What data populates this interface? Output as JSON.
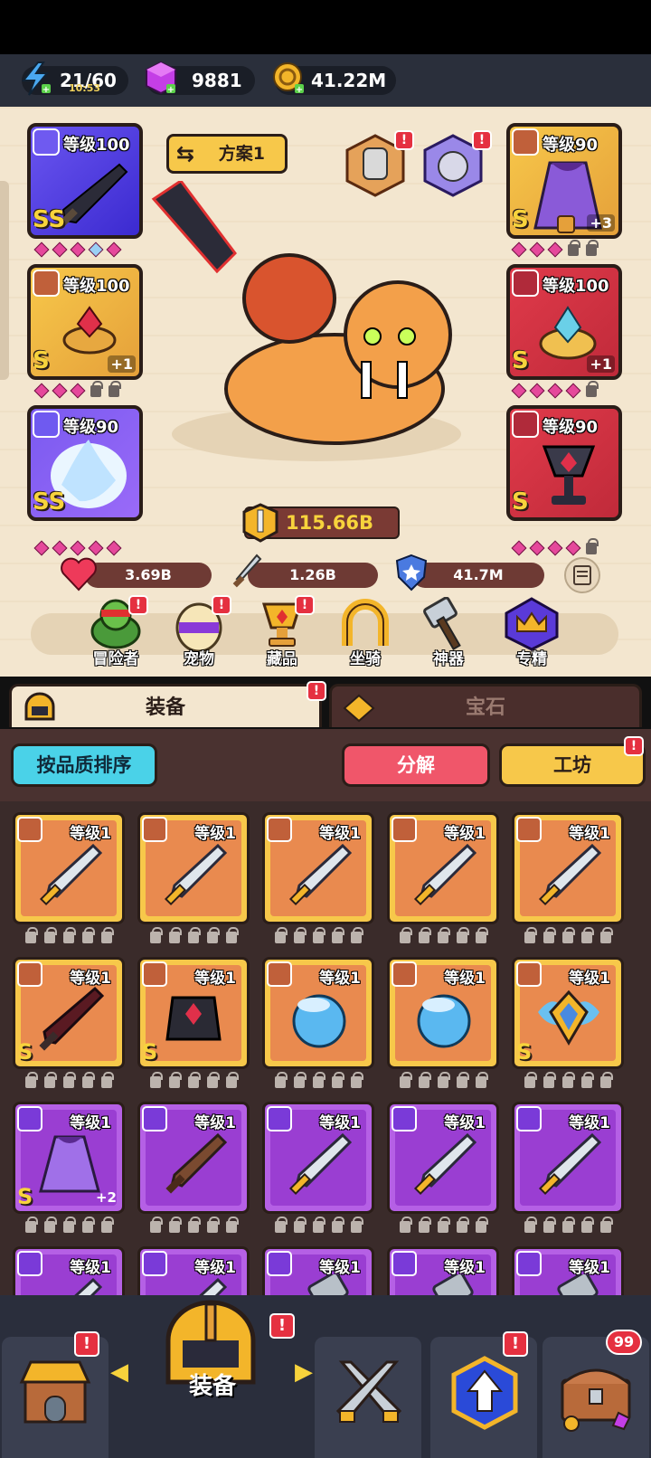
{
  "resources": {
    "energy": "21/60",
    "energy_timer": "10:53",
    "gems": "9881",
    "gold": "41.22M"
  },
  "loadout": {
    "plan_label": "方案1"
  },
  "equipped": {
    "weapon": {
      "level": "等级100",
      "grade": "SS"
    },
    "cape": {
      "level": "等级90",
      "grade": "S",
      "plus": "+3"
    },
    "ring": {
      "level": "等级100",
      "grade": "S",
      "plus": "+1"
    },
    "crown": {
      "level": "等级100",
      "grade": "S",
      "plus": "+1"
    },
    "amulet": {
      "level": "等级90",
      "grade": "SS"
    },
    "chalice": {
      "level": "等级90",
      "grade": "S"
    }
  },
  "power": "115.66B",
  "stats": {
    "hp": "3.69B",
    "attack": "1.26B",
    "defense": "41.7M"
  },
  "categories": [
    "冒险者",
    "宠物",
    "藏品",
    "坐骑",
    "神器",
    "专精"
  ],
  "tabs": {
    "equipment": "装备",
    "gems": "宝石"
  },
  "actions": {
    "sort": "按品质排序",
    "dismantle": "分解",
    "workshop": "工坊"
  },
  "inventory_rows": [
    [
      {
        "level": "等级1",
        "color": "orange",
        "icon": "sword-icon"
      },
      {
        "level": "等级1",
        "color": "orange",
        "icon": "sword-icon"
      },
      {
        "level": "等级1",
        "color": "orange",
        "icon": "sword-icon"
      },
      {
        "level": "等级1",
        "color": "orange",
        "icon": "sword-icon"
      },
      {
        "level": "等级1",
        "color": "orange",
        "icon": "sword-icon"
      }
    ],
    [
      {
        "level": "等级1",
        "color": "orange",
        "icon": "greatsword-icon",
        "grade": "S"
      },
      {
        "level": "等级1",
        "color": "orange",
        "icon": "armor-icon",
        "grade": "S"
      },
      {
        "level": "等级1",
        "color": "orange",
        "icon": "orb-icon"
      },
      {
        "level": "等级1",
        "color": "orange",
        "icon": "orb-icon"
      },
      {
        "level": "等级1",
        "color": "orange",
        "icon": "winged-shield-icon",
        "grade": "S"
      }
    ],
    [
      {
        "level": "等级1",
        "color": "purple",
        "icon": "cape-icon",
        "grade": "S",
        "plus": "+2"
      },
      {
        "level": "等级1",
        "color": "purple",
        "icon": "wooden-sword-icon"
      },
      {
        "level": "等级1",
        "color": "purple",
        "icon": "sword-icon"
      },
      {
        "level": "等级1",
        "color": "purple",
        "icon": "sword-icon"
      },
      {
        "level": "等级1",
        "color": "purple",
        "icon": "sword-icon"
      }
    ],
    [
      {
        "level": "等级1",
        "color": "purple",
        "icon": "sword-icon"
      },
      {
        "level": "等级1",
        "color": "purple",
        "icon": "sword-icon"
      },
      {
        "level": "等级1",
        "color": "purple",
        "icon": "hammer-icon"
      },
      {
        "level": "等级1",
        "color": "purple",
        "icon": "hammer-icon"
      },
      {
        "level": "等级1",
        "color": "purple",
        "icon": "hammer-icon"
      }
    ]
  ],
  "bottom_nav": {
    "active_label": "装备",
    "chest_count": "99"
  },
  "colors": {
    "orange_frame": "#f7c84a",
    "purple_frame": "#b560e5",
    "alert_red": "#e53040",
    "panel_bg": "#f3e6cf"
  }
}
